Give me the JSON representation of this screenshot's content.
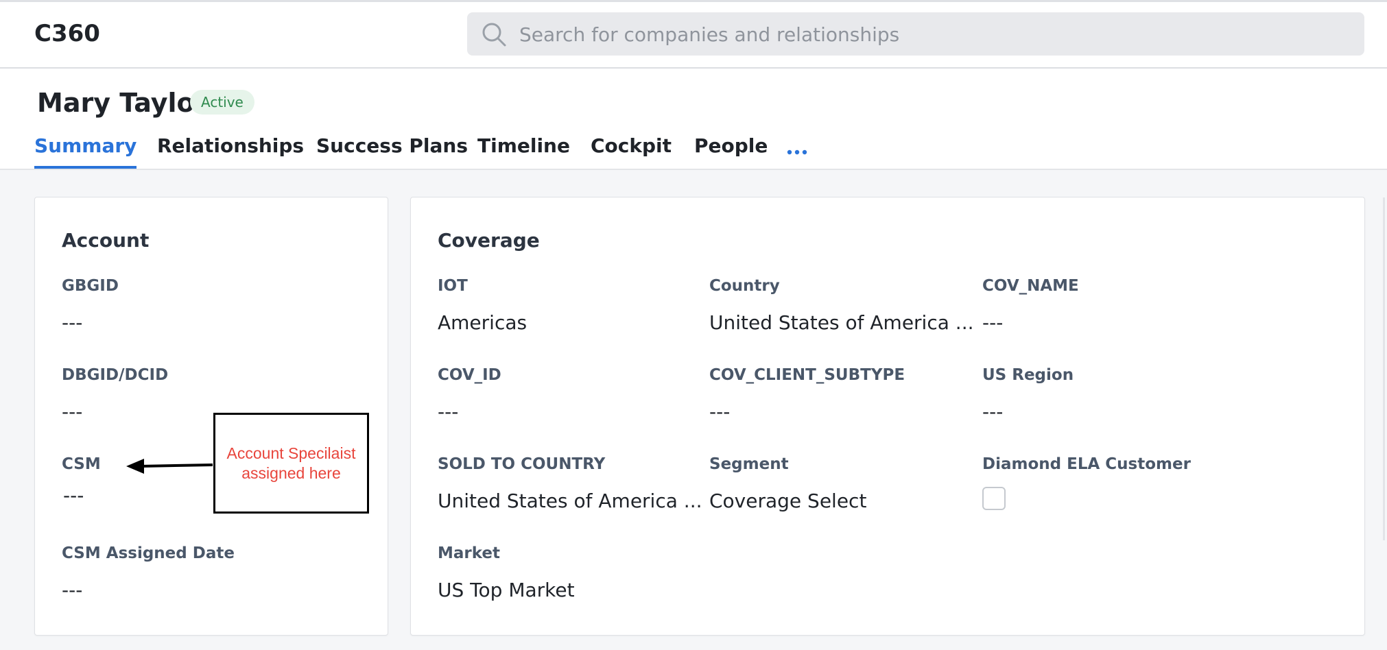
{
  "app": {
    "title": "C360"
  },
  "search": {
    "placeholder": "Search for companies and relationships",
    "value": ""
  },
  "profile": {
    "name": "Mary Taylor",
    "status": "Active"
  },
  "tabs": [
    {
      "label": "Summary",
      "active": true
    },
    {
      "label": "Relationships",
      "active": false
    },
    {
      "label": "Success Plans",
      "active": false
    },
    {
      "label": "Timeline",
      "active": false
    },
    {
      "label": "Cockpit",
      "active": false
    },
    {
      "label": "People",
      "active": false
    }
  ],
  "more_tabs_icon": "ellipsis-icon",
  "account": {
    "title": "Account",
    "fields": [
      {
        "label": "GBGID",
        "value": "---"
      },
      {
        "label": "DBGID/DCID",
        "value": "---"
      },
      {
        "label": "CSM",
        "value": "---"
      },
      {
        "label": "CSM Assigned Date",
        "value": "---"
      }
    ]
  },
  "annotation": {
    "text_line1": "Account Specilaist",
    "text_line2": "assigned here"
  },
  "coverage": {
    "title": "Coverage",
    "fields": [
      {
        "label": "IOT",
        "value": "Americas"
      },
      {
        "label": "Country",
        "value": "United States of America ..."
      },
      {
        "label": "COV_NAME",
        "value": "---"
      },
      {
        "label": "COV_ID",
        "value": "---"
      },
      {
        "label": "COV_CLIENT_SUBTYPE",
        "value": "---"
      },
      {
        "label": "US Region",
        "value": "---"
      },
      {
        "label": "SOLD TO COUNTRY",
        "value": "United States of America ..."
      },
      {
        "label": "Segment",
        "value": "Coverage Select"
      },
      {
        "label": "Diamond ELA Customer",
        "checked": false
      },
      {
        "label": "Market",
        "value": "US Top Market"
      }
    ]
  },
  "colors": {
    "accent": "#2a73d9",
    "status_text": "#2f8a4e",
    "status_bg": "#e6f4ea",
    "annotation": "#e8453c"
  }
}
